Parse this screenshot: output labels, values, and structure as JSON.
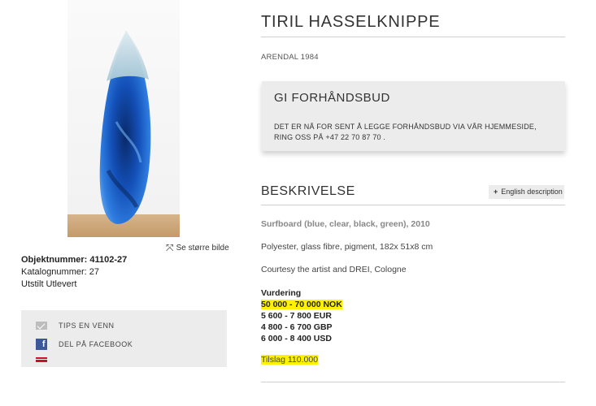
{
  "artist": {
    "name": "TIRIL HASSELKNIPPE",
    "birth": "ARENDAL 1984"
  },
  "image_link": {
    "label": "Se større bilde",
    "icon": "expand-icon"
  },
  "meta": {
    "object_number": "Objektnummer: 41102-27",
    "catalog_number": "Katalognummer: 27",
    "status": "Utstilt Utlevert"
  },
  "share": {
    "tip": "TIPS EN VENN",
    "facebook": "DEL PÅ FACEBOOK",
    "tip_icon": "mail-icon",
    "facebook_icon": "facebook-icon"
  },
  "bid": {
    "title": "GI FORHÅNDSBUD",
    "text": "DET ER NÅ FOR SENT Å LEGGE FORHÅNDSBUD VIA VÅR HJEMMESIDE, RING OSS PÅ +47 22 70 87 70 ."
  },
  "description": {
    "title": "BESKRIVELSE",
    "english_button": "English description",
    "work_title": "Surfboard (blue, clear, black, green), 2010",
    "material": "Polyester, glass fibre, pigment, 182x 51x8 cm",
    "courtesy": "Courtesy the artist and DREI, Cologne"
  },
  "valuation": {
    "label": "Vurdering",
    "nok": "50 000 - 70 000 NOK",
    "eur": "5 600 - 7 800 EUR",
    "gbp": "4 800 - 6 700 GBP",
    "usd": "6 000 - 8 400 USD"
  },
  "hammer": "Tilslag 110.000",
  "colors": {
    "highlight": "#fff200",
    "panel": "#ececec",
    "facebook": "#3b5998"
  }
}
